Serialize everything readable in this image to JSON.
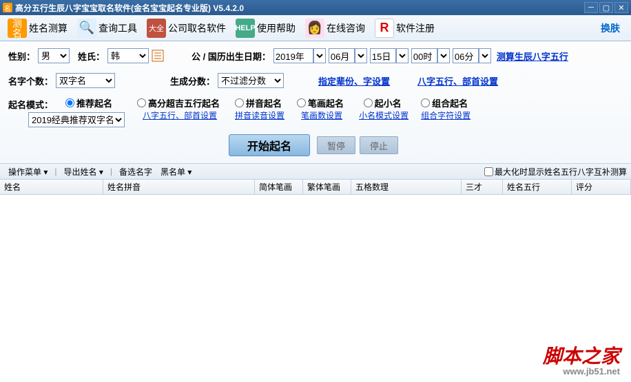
{
  "titlebar": {
    "title": "高分五行生辰八字宝宝取名软件(金名宝宝起名专业版)  V5.4.2.0"
  },
  "toolbar": {
    "items": [
      {
        "label": "姓名测算"
      },
      {
        "label": "查询工具"
      },
      {
        "label": "公司取名软件"
      },
      {
        "label": "使用帮助"
      },
      {
        "label": "在线咨询"
      },
      {
        "label": "软件注册"
      }
    ],
    "skin": "换肤"
  },
  "form": {
    "gender_lbl": "性别：",
    "gender_val": "男",
    "surname_lbl": "姓氏：",
    "surname_val": "韩",
    "birth_lbl": "公 / 国历出生日期：",
    "year": "2019年",
    "month": "06月",
    "day": "15日",
    "hour": "00时",
    "min": "06分",
    "calc_link": "测算生辰八字五行",
    "count_lbl": "名字个数：",
    "count_val": "双字名",
    "score_lbl": "生成分数：",
    "score_val": "不过滤分数",
    "gen_link": "指定辈份、字设置",
    "wuxing_link": "八字五行、部首设置",
    "mode_lbl": "起名模式：",
    "modes": [
      {
        "label": "推荐起名",
        "sub": "2019经典推荐双字名"
      },
      {
        "label": "高分超吉五行起名",
        "sub": "八字五行、部首设置"
      },
      {
        "label": "拼音起名",
        "sub": "拼音读音设置"
      },
      {
        "label": "笔画起名",
        "sub": "笔画数设置"
      },
      {
        "label": "起小名",
        "sub": "小名模式设置"
      },
      {
        "label": "组合起名",
        "sub": "组合字符设置"
      }
    ],
    "start": "开始起名",
    "pause": "暂停",
    "stop": "停止"
  },
  "menubar": {
    "m1": "操作菜单",
    "m2": "导出姓名",
    "m3": "备选名字",
    "m4": "黑名单",
    "chk": "最大化时显示姓名五行八字互补测算"
  },
  "table": {
    "cols": [
      "姓名",
      "姓名拼音",
      "简体笔画",
      "繁体笔画",
      "五格数理",
      "三才",
      "姓名五行",
      "评分"
    ]
  },
  "watermark": {
    "text": "脚本之家",
    "url": "www.jb51.net"
  }
}
